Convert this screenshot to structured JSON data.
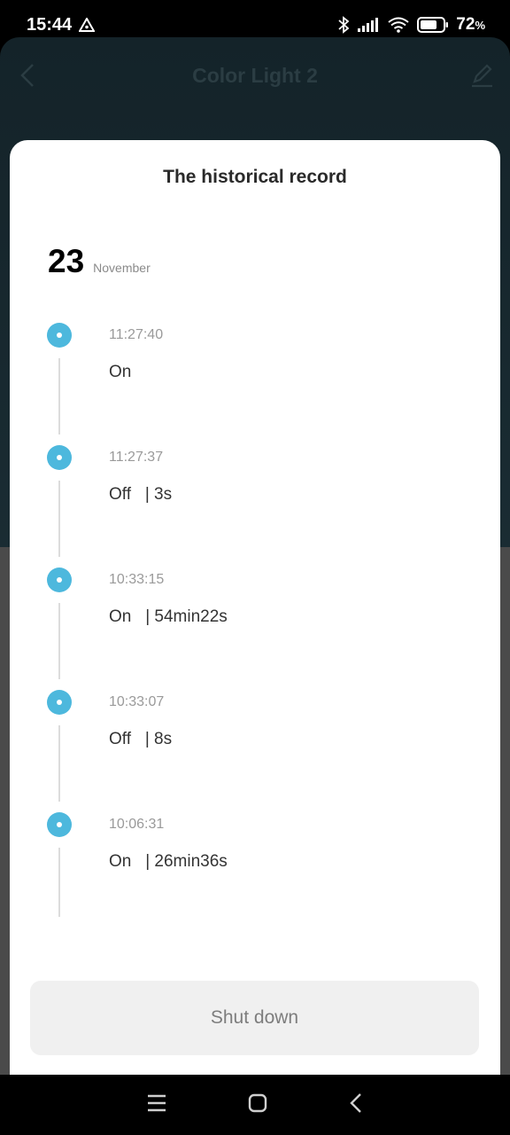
{
  "status_bar": {
    "time": "15:44",
    "battery": "72",
    "battery_unit": "%",
    "icons": [
      "alert-triangle-icon",
      "bluetooth-icon",
      "signal-icon",
      "wifi-icon",
      "battery-icon"
    ]
  },
  "app": {
    "title": "Color Light 2"
  },
  "sheet": {
    "title": "The historical record",
    "date_day": "23",
    "date_month": "November",
    "entries": [
      {
        "time": "11:27:40",
        "state": "On",
        "duration": ""
      },
      {
        "time": "11:27:37",
        "state": "Off",
        "duration": "| 3s"
      },
      {
        "time": "10:33:15",
        "state": "On",
        "duration": "| 54min22s"
      },
      {
        "time": "10:33:07",
        "state": "Off",
        "duration": "| 8s"
      },
      {
        "time": "10:06:31",
        "state": "On",
        "duration": "| 26min36s"
      }
    ],
    "shutdown_label": "Shut down"
  },
  "colors": {
    "accent_dot": "#4db8dd"
  }
}
